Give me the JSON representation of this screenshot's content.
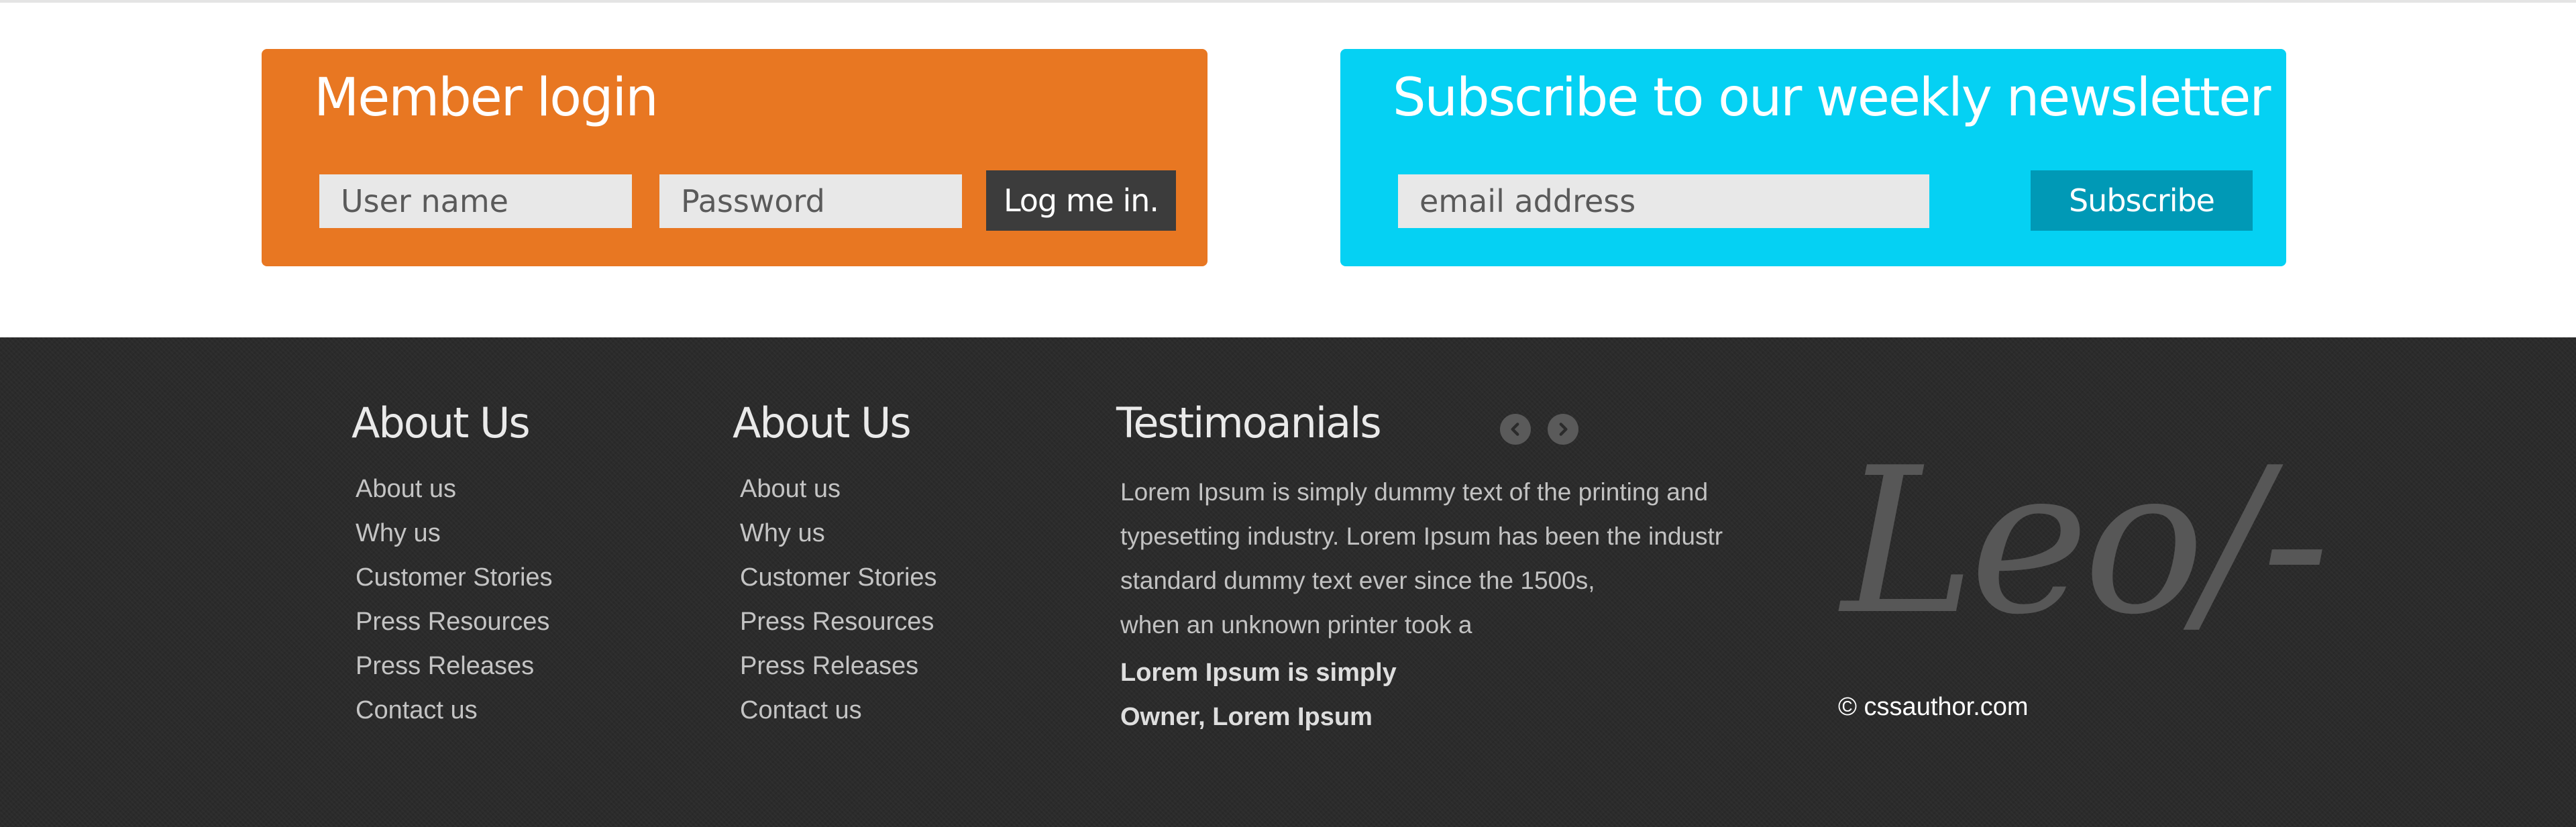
{
  "login": {
    "title": "Member login",
    "username_placeholder": "User name",
    "password_placeholder": "Password",
    "submit_label": "Log me in."
  },
  "newsletter": {
    "title": "Subscribe to our weekly newsletter",
    "email_placeholder": "email address",
    "submit_label": "Subscribe"
  },
  "footer": {
    "col1": {
      "title": "About Us",
      "links": [
        "About us",
        "Why us",
        "Customer Stories",
        "Press Resources",
        "Press Releases",
        "Contact us"
      ]
    },
    "col2": {
      "title": "About Us",
      "links": [
        "About us",
        "Why us",
        "Customer Stories",
        "Press Resources",
        "Press Releases",
        "Contact us"
      ]
    },
    "testimonials": {
      "title": "Testimoanials",
      "prev_icon": "chevron-left-icon",
      "next_icon": "chevron-right-icon",
      "lines": [
        "Lorem Ipsum is simply dummy text of the printing and",
        "typesetting industry. Lorem Ipsum has been the industr",
        "standard dummy text ever since the 1500s,",
        "when an unknown printer took a"
      ],
      "author_name": "Lorem Ipsum is simply",
      "author_role": "Owner, Lorem Ipsum"
    },
    "signature": "Leo/-",
    "copyright": "© cssauthor.com"
  },
  "colors": {
    "login_bg": "#e87722",
    "newsletter_bg": "#05d1f3",
    "login_button": "#3c3c3c",
    "subscribe_button": "#0099b6",
    "footer_bg": "#2b2b2b"
  }
}
